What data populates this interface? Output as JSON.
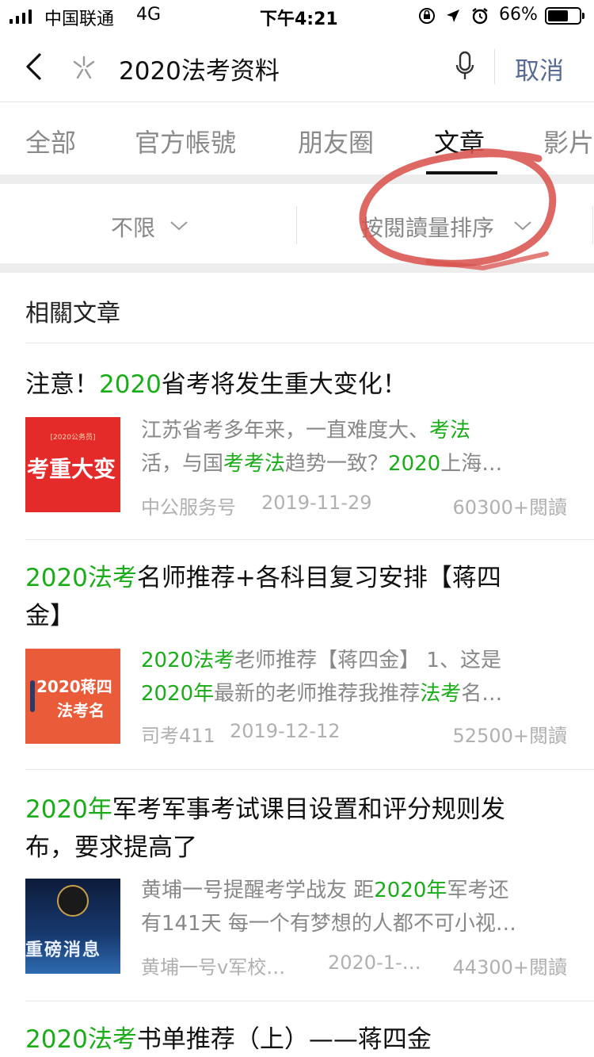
{
  "status_bar": {
    "carrier": "中国联通",
    "network": "4G",
    "time": "下午4:21",
    "battery": "66%",
    "battery_level": 0.66
  },
  "search": {
    "query": "2020法考资料",
    "cancel_label": "取消",
    "back_icon": "chevron-left-icon",
    "logo_icon": "search-logo-icon",
    "mic_icon": "microphone-icon"
  },
  "tabs": [
    "全部",
    "官方帳號",
    "朋友圈",
    "文章",
    "影片"
  ],
  "active_tab": "文章",
  "filters": {
    "time": "不限",
    "sort": "按閱讀量排序"
  },
  "section_title": "相關文章",
  "articles": [
    {
      "title_parts": [
        {
          "text": "注意！",
          "hl": false
        },
        {
          "text": "2020",
          "hl": true
        },
        {
          "text": "省考将发生重大变化！",
          "hl": false
        }
      ],
      "title_line2_parts": [],
      "summary_line1": [
        {
          "text": "江苏省考多年来，一直难度大、",
          "hl": false
        },
        {
          "text": "考法",
          "hl": true
        }
      ],
      "summary_line2": [
        {
          "text": "活，与国",
          "hl": false
        },
        {
          "text": "考考法",
          "hl": true
        },
        {
          "text": "趋势一致？",
          "hl": false
        },
        {
          "text": "2020",
          "hl": true
        },
        {
          "text": "上海…",
          "hl": false
        }
      ],
      "source": "中公服务号",
      "date": "2019-11-29",
      "reads": "60300+閱讀",
      "thumb_banner": "[2020公务员]",
      "thumb_text": "考重大变"
    },
    {
      "title_parts": [
        {
          "text": "2020法考",
          "hl": true
        },
        {
          "text": "名师推荐+各科目复习安排【蒋四",
          "hl": false
        }
      ],
      "title_line2_parts": [
        {
          "text": "金】",
          "hl": false
        }
      ],
      "summary_line1": [
        {
          "text": "2020法考",
          "hl": true
        },
        {
          "text": "老师推荐【蒋四金】 1、这是",
          "hl": false
        }
      ],
      "summary_line2": [
        {
          "text": "2020年",
          "hl": true
        },
        {
          "text": "最新的老师推荐我推荐",
          "hl": false
        },
        {
          "text": "法考",
          "hl": true
        },
        {
          "text": "名…",
          "hl": false
        }
      ],
      "source": "司考411",
      "date": "2019-12-12",
      "reads": "52500+閱讀",
      "thumb_text_1": "2020蒋四",
      "thumb_text_2": "法考名"
    },
    {
      "title_parts": [
        {
          "text": "2020年",
          "hl": true
        },
        {
          "text": "军考军事考试课目设置和评分规则发",
          "hl": false
        }
      ],
      "title_line2_parts": [
        {
          "text": "布，要求提高了",
          "hl": false
        }
      ],
      "summary_line1": [
        {
          "text": "黄埔一号提醒考学战友 距",
          "hl": false
        },
        {
          "text": "2020年",
          "hl": true
        },
        {
          "text": "军考还",
          "hl": false
        }
      ],
      "summary_line2": [
        {
          "text": "有141天 每一个有梦想的人都不可小视…",
          "hl": false
        }
      ],
      "source": "黄埔一号v军校…",
      "date": "2020-1-…",
      "reads": "44300+閱讀",
      "thumb_text": "重磅消息"
    },
    {
      "title_parts": [
        {
          "text": "2020法考",
          "hl": true
        },
        {
          "text": "书单推荐（上）——蒋四金",
          "hl": false
        }
      ],
      "title_line2_parts": []
    }
  ],
  "colors": {
    "highlight": "#1aad19",
    "cancel": "#576b95",
    "annotation": "#d9534f"
  }
}
